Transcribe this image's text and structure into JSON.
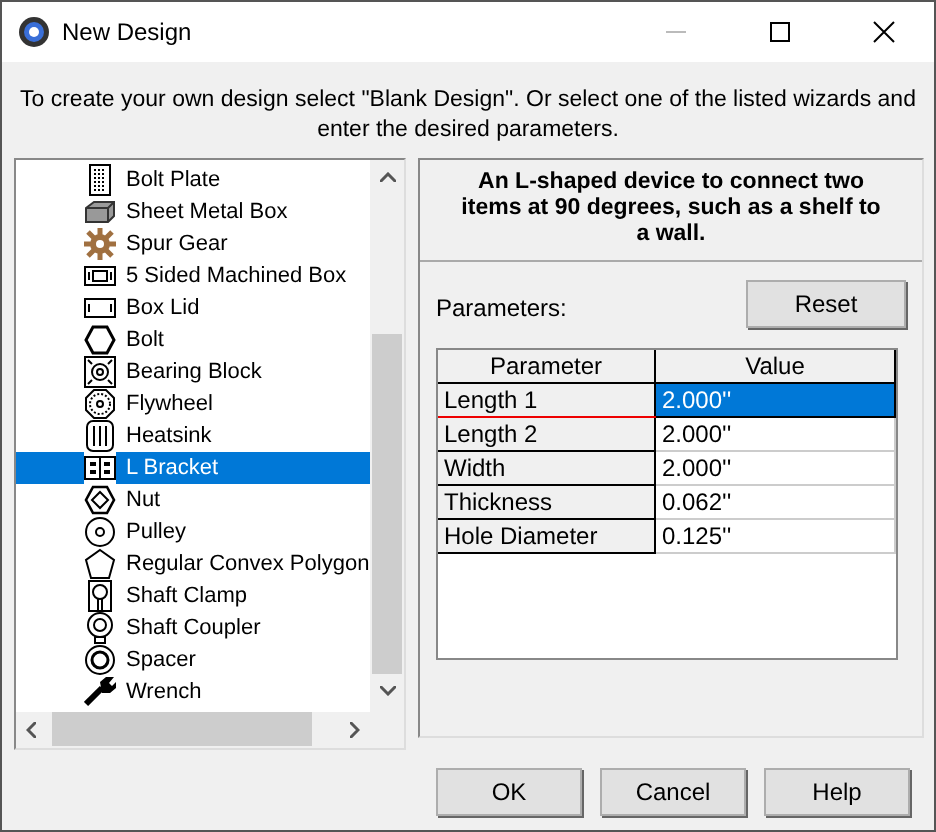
{
  "window": {
    "title": "New Design"
  },
  "instruction": "To create your own design select \"Blank Design\". Or select one of the listed wizards and enter the desired parameters.",
  "wizards": [
    {
      "label": "Bolt Plate",
      "selected": false
    },
    {
      "label": "Sheet Metal Box",
      "selected": false
    },
    {
      "label": "Spur Gear",
      "selected": false
    },
    {
      "label": "5 Sided Machined Box",
      "selected": false
    },
    {
      "label": "Box Lid",
      "selected": false
    },
    {
      "label": "Bolt",
      "selected": false
    },
    {
      "label": "Bearing Block",
      "selected": false
    },
    {
      "label": "Flywheel",
      "selected": false
    },
    {
      "label": "Heatsink",
      "selected": false
    },
    {
      "label": "L Bracket",
      "selected": true
    },
    {
      "label": "Nut",
      "selected": false
    },
    {
      "label": "Pulley",
      "selected": false
    },
    {
      "label": "Regular Convex Polygon",
      "selected": false
    },
    {
      "label": "Shaft Clamp",
      "selected": false
    },
    {
      "label": "Shaft Coupler",
      "selected": false
    },
    {
      "label": "Spacer",
      "selected": false
    },
    {
      "label": "Wrench",
      "selected": false
    }
  ],
  "description": "An L-shaped device to connect two items at 90 degrees, such as a shelf to a wall.",
  "parameters_label": "Parameters:",
  "reset_button": "Reset",
  "table": {
    "columns": [
      "Parameter",
      "Value"
    ],
    "rows": [
      {
        "parameter": "Length 1",
        "value": "2.000''",
        "selected": true
      },
      {
        "parameter": "Length 2",
        "value": "2.000''",
        "selected": false
      },
      {
        "parameter": "Width",
        "value": "2.000''",
        "selected": false
      },
      {
        "parameter": "Thickness",
        "value": "0.062''",
        "selected": false
      },
      {
        "parameter": "Hole Diameter",
        "value": "0.125''",
        "selected": false
      }
    ]
  },
  "buttons": [
    "OK",
    "Cancel",
    "Help"
  ]
}
